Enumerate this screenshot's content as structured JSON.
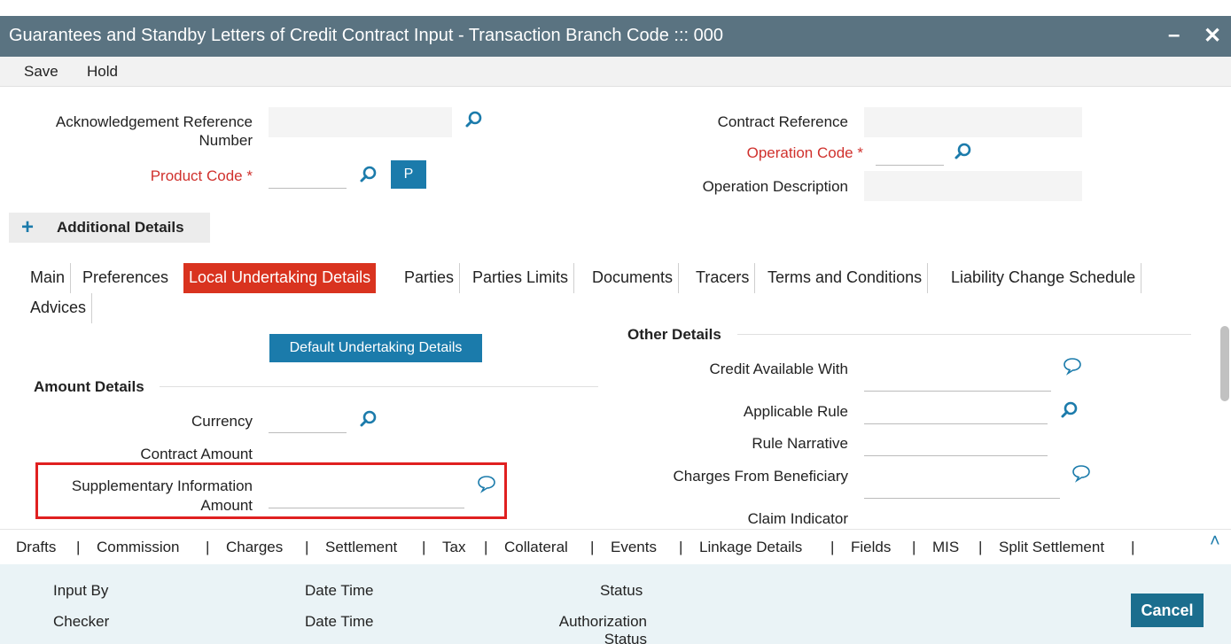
{
  "window": {
    "title": "Guarantees and Standby Letters of Credit Contract Input - Transaction Branch Code ::: 000",
    "minimize_glyph": "–",
    "close_glyph": "✕"
  },
  "menu": {
    "save": "Save",
    "hold": "Hold"
  },
  "header": {
    "ack_ref_label_1": "Acknowledgement Reference",
    "ack_ref_label_2": "Number",
    "product_code_label": "Product Code",
    "required_mark": "*",
    "p_button": "P",
    "contract_ref_label": "Contract Reference",
    "operation_code_label": "Operation Code",
    "operation_desc_label": "Operation Description",
    "ack_ref_value": "",
    "product_code_value": "",
    "contract_ref_value": "",
    "operation_code_value": "",
    "operation_desc_value": ""
  },
  "additional_details": {
    "plus": "+",
    "label": "Additional Details"
  },
  "tabs": [
    "Main",
    "Preferences",
    "Local Undertaking Details",
    "Parties",
    "Parties Limits",
    "Documents",
    "Tracers",
    "Terms and Conditions",
    "Liability Change Schedule",
    "Advices"
  ],
  "active_tab": "Local Undertaking Details",
  "local_undertaking": {
    "default_button": "Default Undertaking Details",
    "amount_section": "Amount Details",
    "currency_label": "Currency",
    "contract_amount_label": "Contract Amount",
    "supp_info_label_1": "Supplementary Information",
    "supp_info_label_2": "Amount",
    "other_section": "Other Details",
    "credit_available_label": "Credit Available With",
    "applicable_rule_label": "Applicable Rule",
    "rule_narrative_label": "Rule Narrative",
    "charges_from_benef_label": "Charges From Beneficiary",
    "claim_indicator_label": "Claim Indicator"
  },
  "subsystems": [
    "Drafts",
    "Commission",
    "Charges",
    "Settlement",
    "Tax",
    "Collateral",
    "Events",
    "Linkage Details",
    "Fields",
    "MIS",
    "Split Settlement"
  ],
  "subsystem_separator": "|",
  "collapse_caret": "˄",
  "footer": {
    "input_by": "Input By",
    "date_time_1": "Date Time",
    "status": "Status",
    "checker": "Checker",
    "date_time_2": "Date Time",
    "authorization_1": "Authorization",
    "authorization_2": "Status",
    "cancel": "Cancel"
  },
  "icons": {
    "search": "search-icon",
    "comment": "comment-icon"
  },
  "colors": {
    "titlebar": "#5a7381",
    "accent_blue": "#1b7bab",
    "active_tab": "#d9331f",
    "required_label": "#d0312d",
    "highlight_box": "#e02020",
    "footer_bg": "#eaf3f6"
  }
}
